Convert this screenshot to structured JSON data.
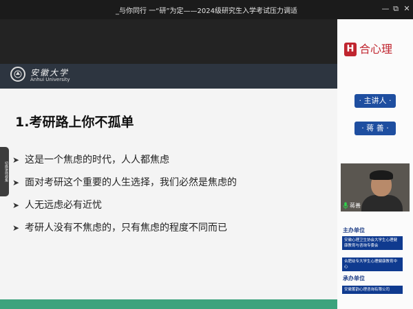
{
  "window": {
    "title": "_与你同行 一“研”为定——2024级研究生入学考试压力调适",
    "minimize": "—",
    "maximize": "⧉",
    "close": "✕"
  },
  "slide": {
    "university_cn": "安徽大学",
    "university_en": "Anhui University",
    "title": "1.考研路上你不孤单",
    "bullets": [
      "这是一个焦虑的时代，人人都焦虑",
      "面对考研这个重要的人生选择，我们必然是焦虑的",
      "人无远虑必有近忧",
      "考研人没有不焦虑的，只有焦虑的程度不同而已"
    ],
    "side_tab": "切换讲师视角"
  },
  "panel": {
    "brand_badge": "H",
    "brand_text": "合心理",
    "speaker_label": "· 主讲人 ·",
    "speaker_name": "· 蒋 善 ·",
    "video_name": "蒋善",
    "host_label": "主办单位",
    "hosts": [
      "安徽心理卫生协会大学生心理健康教育与咨询专委会",
      "合肥幼专大学生心理健康教育中心"
    ],
    "organizer_label": "承办单位",
    "organizers": [
      "安徽蓄韵心理咨询有限公司"
    ]
  },
  "colors": {
    "accent_blue": "#1e4ea0",
    "brand_red": "#c0252f",
    "footer_green": "#3da37d",
    "header_dark": "#2d3540"
  }
}
